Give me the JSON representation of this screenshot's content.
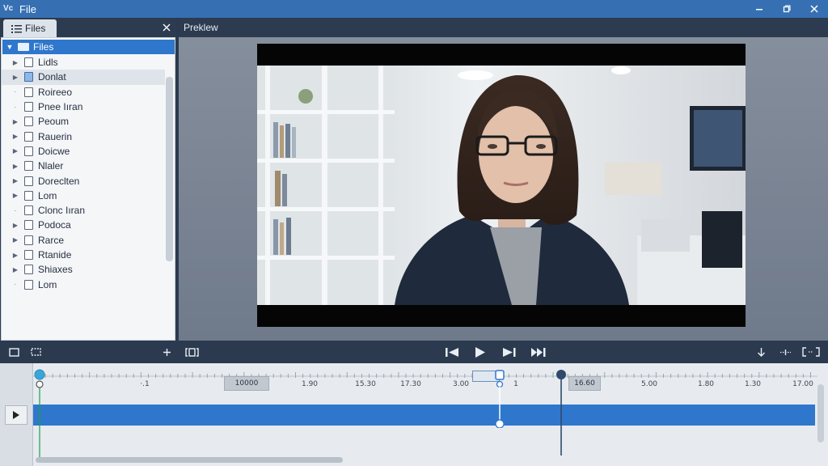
{
  "window": {
    "title": "File",
    "app_icon_text": "Vc",
    "controls": [
      "minimize",
      "restore",
      "close"
    ]
  },
  "left_panel": {
    "tab_label": "Files",
    "tab_icon": "list-icon",
    "close_icon": "close-icon",
    "tree": {
      "root_label": "Files",
      "items": [
        {
          "label": "Lidls",
          "expander": true,
          "highlight": false
        },
        {
          "label": "Donlat",
          "expander": true,
          "highlight": true
        },
        {
          "label": "Roireeo",
          "expander": false,
          "highlight": false
        },
        {
          "label": "Pnee Iıran",
          "expander": false,
          "highlight": false
        },
        {
          "label": "Peoum",
          "expander": true,
          "highlight": false
        },
        {
          "label": "Rauerin",
          "expander": true,
          "highlight": false
        },
        {
          "label": "Doicwe",
          "expander": true,
          "highlight": false
        },
        {
          "label": "Nlaler",
          "expander": true,
          "highlight": false
        },
        {
          "label": "Doreclten",
          "expander": true,
          "highlight": false
        },
        {
          "label": "Lom",
          "expander": true,
          "highlight": false
        },
        {
          "label": "Clonc Iıran",
          "expander": false,
          "highlight": false
        },
        {
          "label": "Podoca",
          "expander": true,
          "highlight": false
        },
        {
          "label": "Rarce",
          "expander": true,
          "highlight": false
        },
        {
          "label": "Rtanide",
          "expander": true,
          "highlight": false
        },
        {
          "label": "Shiaxes",
          "expander": true,
          "highlight": false
        },
        {
          "label": "Lom",
          "expander": false,
          "highlight": false
        }
      ]
    }
  },
  "preview": {
    "header": "Preklew"
  },
  "toolbar": {
    "left_icons": [
      "square-icon",
      "crop-icon",
      "plus-icon",
      "aspect-icon"
    ],
    "playback_icons": [
      "skip-back-icon",
      "play-icon",
      "skip-forward-icon",
      "step-forward-icon"
    ],
    "right_icons": [
      "download-icon",
      "move-icon",
      "fit-icon"
    ]
  },
  "timeline": {
    "tick_labels": [
      {
        "text": "·.1",
        "boxed": false
      },
      {
        "text": "10000",
        "boxed": true
      },
      {
        "text": "1.90",
        "boxed": false
      },
      {
        "text": "15.30",
        "boxed": false
      },
      {
        "text": "17.30",
        "boxed": false
      },
      {
        "text": "3.00",
        "boxed": false
      },
      {
        "text": "1",
        "boxed": false
      },
      {
        "text": "16.60",
        "boxed": true
      },
      {
        "text": "5.00",
        "boxed": false
      },
      {
        "text": "1.80",
        "boxed": false
      },
      {
        "text": "1.30",
        "boxed": false
      },
      {
        "text": "17.00",
        "boxed": false
      }
    ],
    "colors": {
      "track": "#2f77cc",
      "start_marker": "#3aa6d8",
      "playhead": "#2e4a6d"
    }
  }
}
